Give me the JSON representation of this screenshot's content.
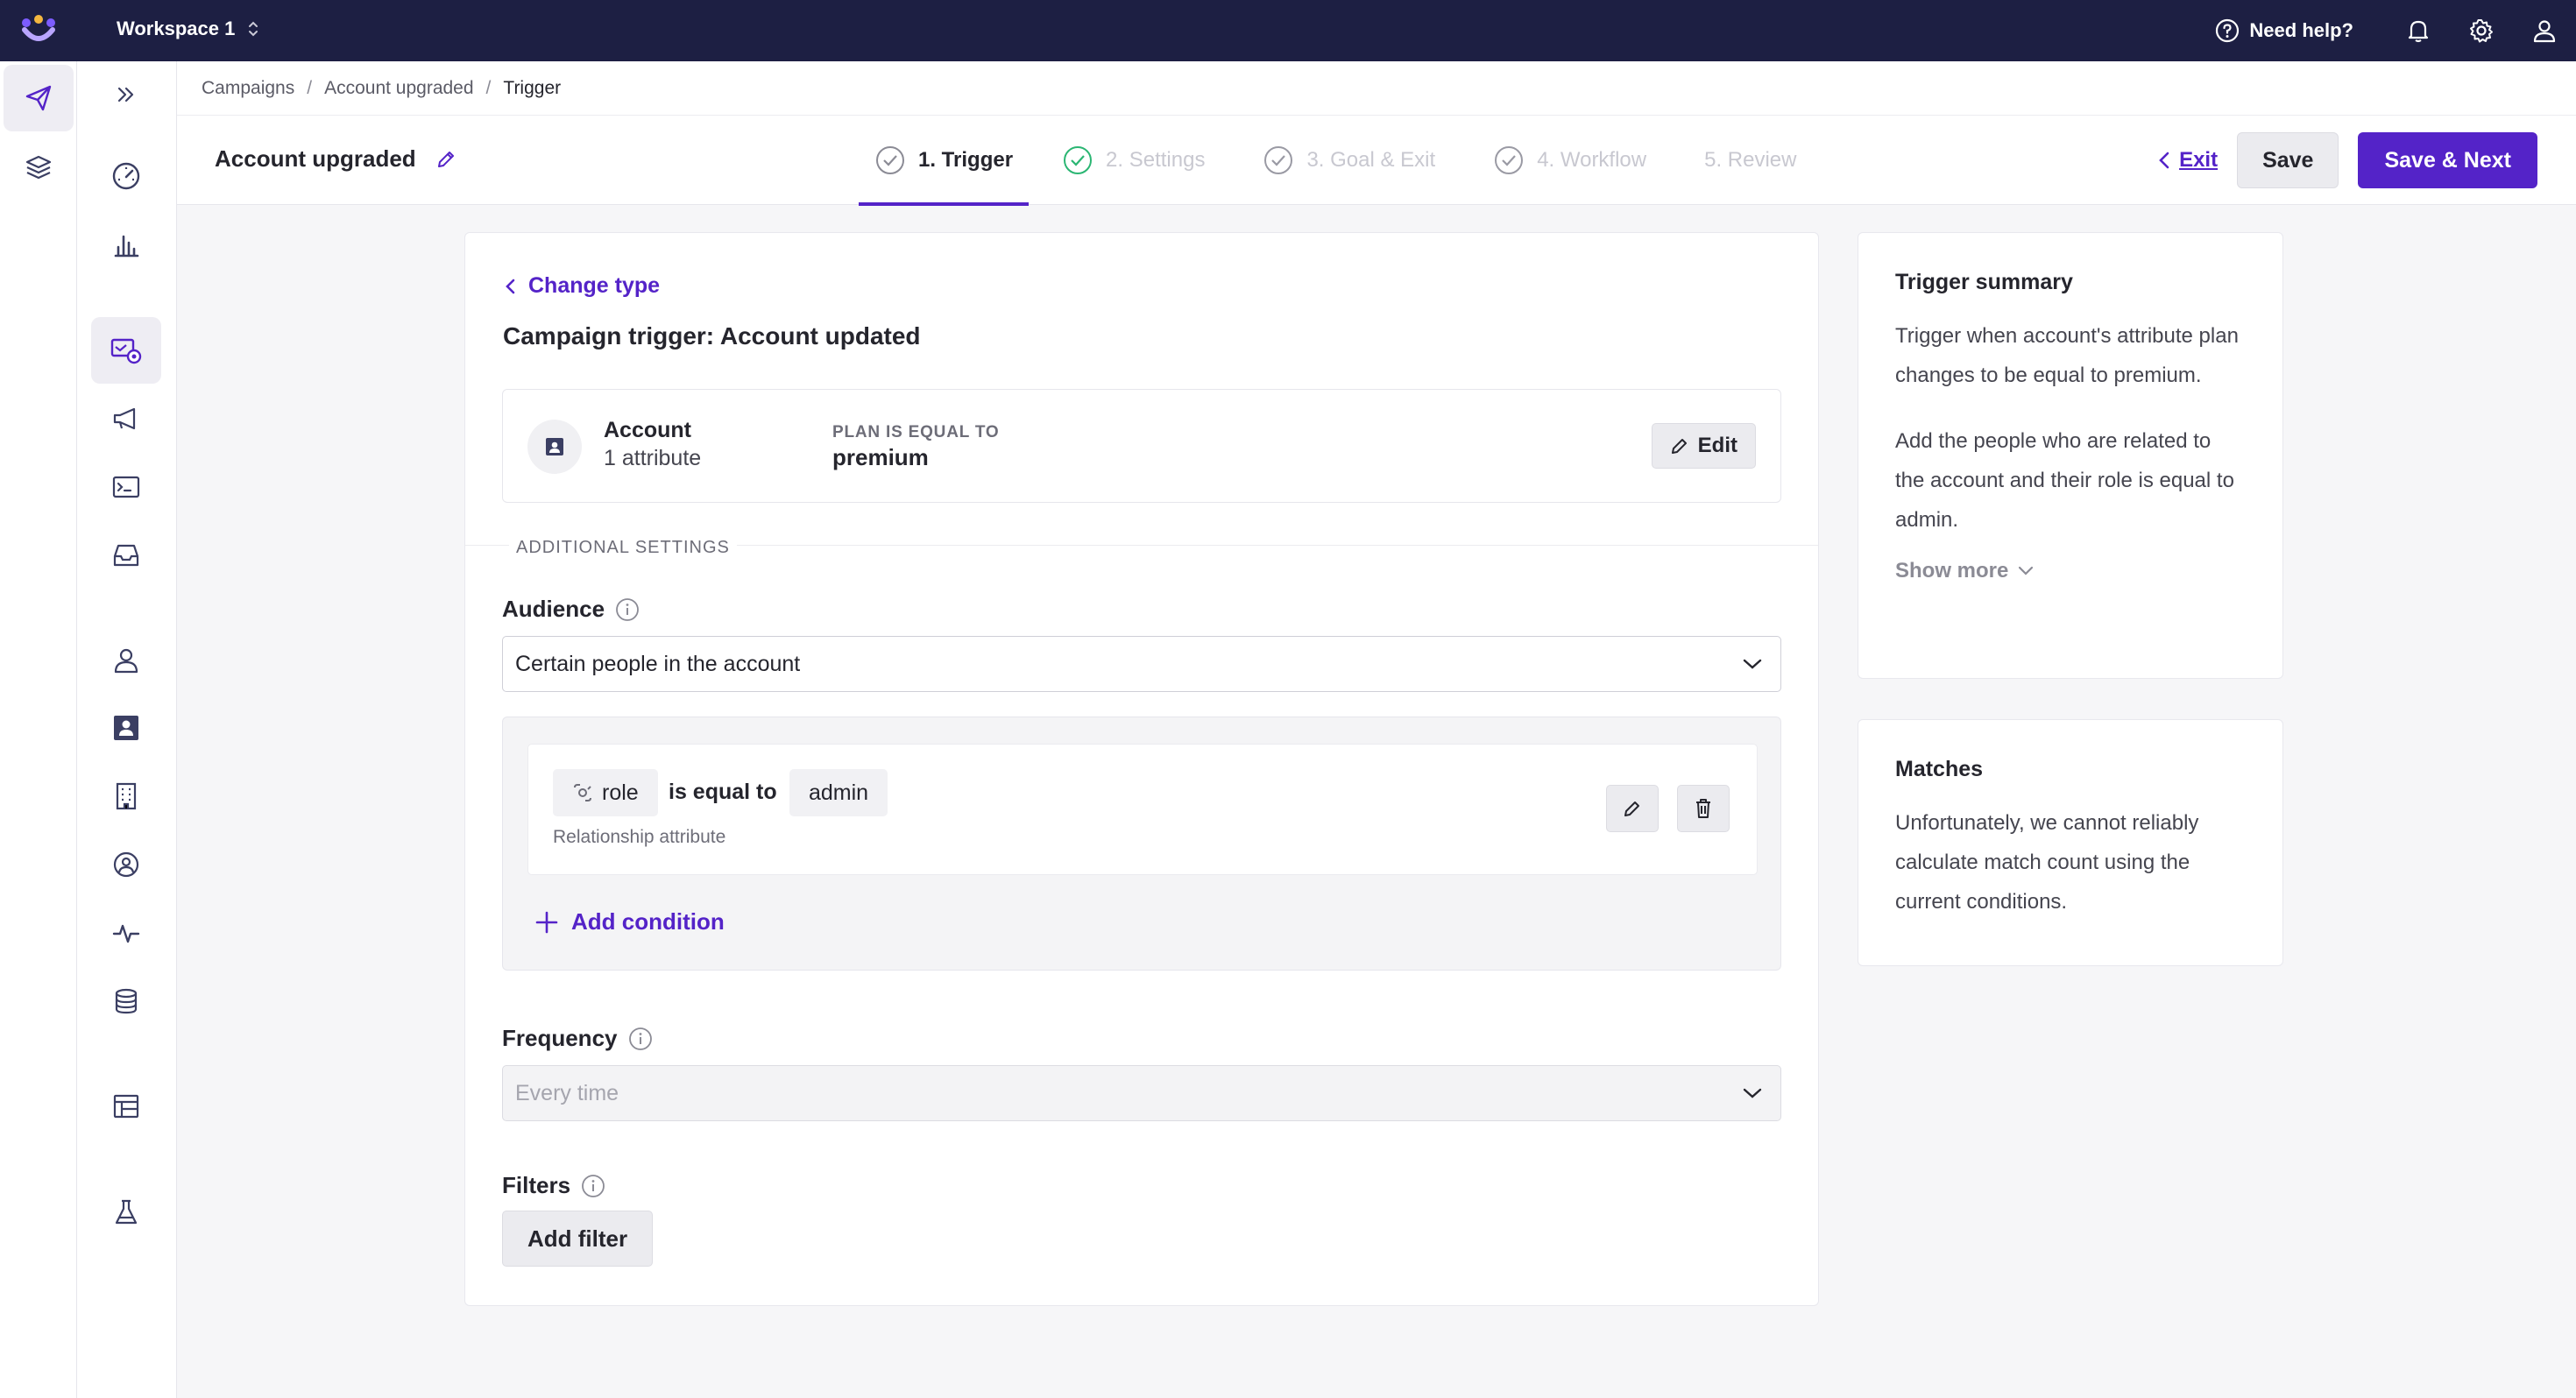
{
  "topbar": {
    "workspace": "Workspace 1",
    "help_label": "Need help?"
  },
  "breadcrumbs": [
    "Campaigns",
    "Account upgraded",
    "Trigger"
  ],
  "header": {
    "campaign_name": "Account upgraded",
    "steps": [
      {
        "label": "1. Trigger",
        "state": "active"
      },
      {
        "label": "2. Settings",
        "state": "inactive"
      },
      {
        "label": "3. Goal & Exit",
        "state": "inactive"
      },
      {
        "label": "4. Workflow",
        "state": "inactive"
      },
      {
        "label": "5. Review",
        "state": "inactive"
      }
    ],
    "exit_label": "Exit",
    "save_label": "Save",
    "save_next_label": "Save & Next"
  },
  "trigger": {
    "change_type_label": "Change type",
    "title": "Campaign trigger: Account updated",
    "object_name": "Account",
    "object_sub": "1 attribute",
    "condition_label": "PLAN IS EQUAL TO",
    "condition_value": "premium",
    "edit_label": "Edit"
  },
  "additional": {
    "section_label": "ADDITIONAL SETTINGS",
    "audience_label": "Audience",
    "audience_value": "Certain people in the account",
    "rule": {
      "attribute": "role",
      "operator": "is equal to",
      "value": "admin",
      "subtext": "Relationship attribute"
    },
    "add_condition_label": "Add condition",
    "frequency_label": "Frequency",
    "frequency_placeholder": "Every time",
    "filters_label": "Filters",
    "add_filter_label": "Add filter"
  },
  "summary": {
    "title": "Trigger summary",
    "p1": "Trigger when account's attribute plan changes to be equal to premium.",
    "p2": "Add the people who are related to the account and their role is equal to admin.",
    "show_more": "Show more"
  },
  "matches": {
    "title": "Matches",
    "text": "Unfortunately, we cannot reliably calculate match count using the current conditions."
  },
  "colors": {
    "topbar": "#1d1f43",
    "accent": "#5423c8"
  }
}
